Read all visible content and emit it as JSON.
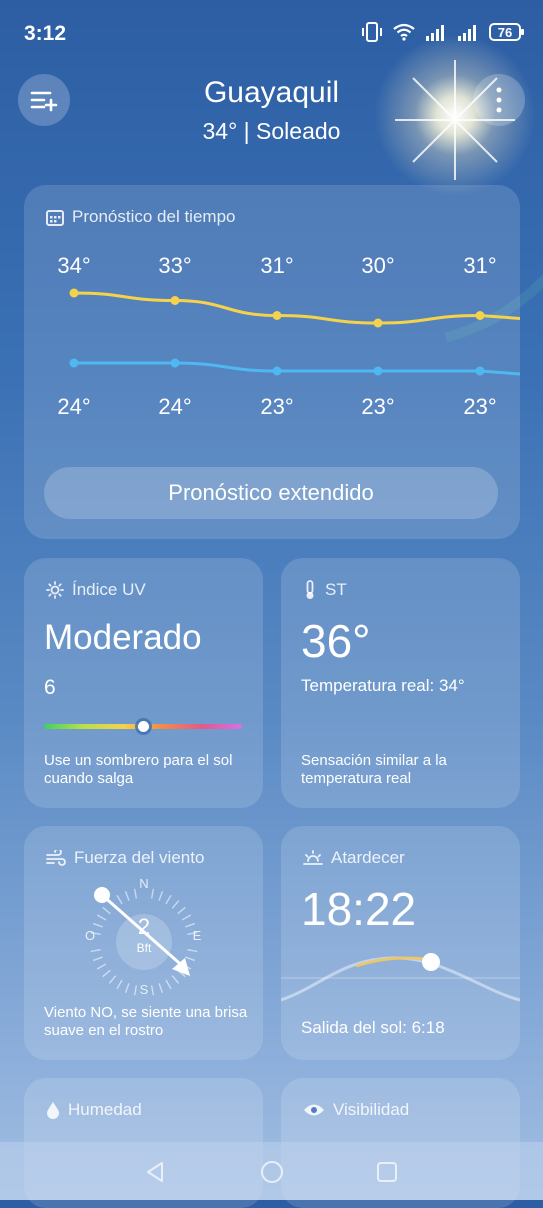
{
  "status": {
    "time": "3:12",
    "battery": "76"
  },
  "header": {
    "city": "Guayaquil",
    "summary": "34° | Soleado"
  },
  "forecast": {
    "title": "Pronóstico del tiempo",
    "highs": [
      "34°",
      "33°",
      "31°",
      "30°",
      "31°"
    ],
    "lows": [
      "24°",
      "24°",
      "23°",
      "23°",
      "23°"
    ],
    "high_values": [
      34,
      33,
      31,
      30,
      31
    ],
    "low_values": [
      24,
      24,
      23,
      23,
      23
    ],
    "extended_button": "Pronóstico extendido",
    "high_color": "#f5d24b",
    "low_color": "#4fb8f0"
  },
  "uv": {
    "title": "Índice UV",
    "level": "Moderado",
    "value": "6",
    "index_fraction": 0.5,
    "advice": "Use un sombrero para el sol cuando salga"
  },
  "feels": {
    "title": "ST",
    "value": "36°",
    "real": "Temperatura real: 34°",
    "description": "Sensación similar a la temperatura real"
  },
  "wind": {
    "title": "Fuerza del viento",
    "force": "2",
    "unit": "Bft",
    "dir_n": "N",
    "dir_e": "E",
    "dir_s": "S",
    "dir_o": "O",
    "description": "Viento NO, se siente una brisa suave en el rostro"
  },
  "sunset": {
    "title": "Atardecer",
    "time": "18:22",
    "sunrise": "Salida del sol: 6:18"
  },
  "humidity": {
    "title": "Humedad"
  },
  "visibility": {
    "title": "Visibilidad"
  }
}
